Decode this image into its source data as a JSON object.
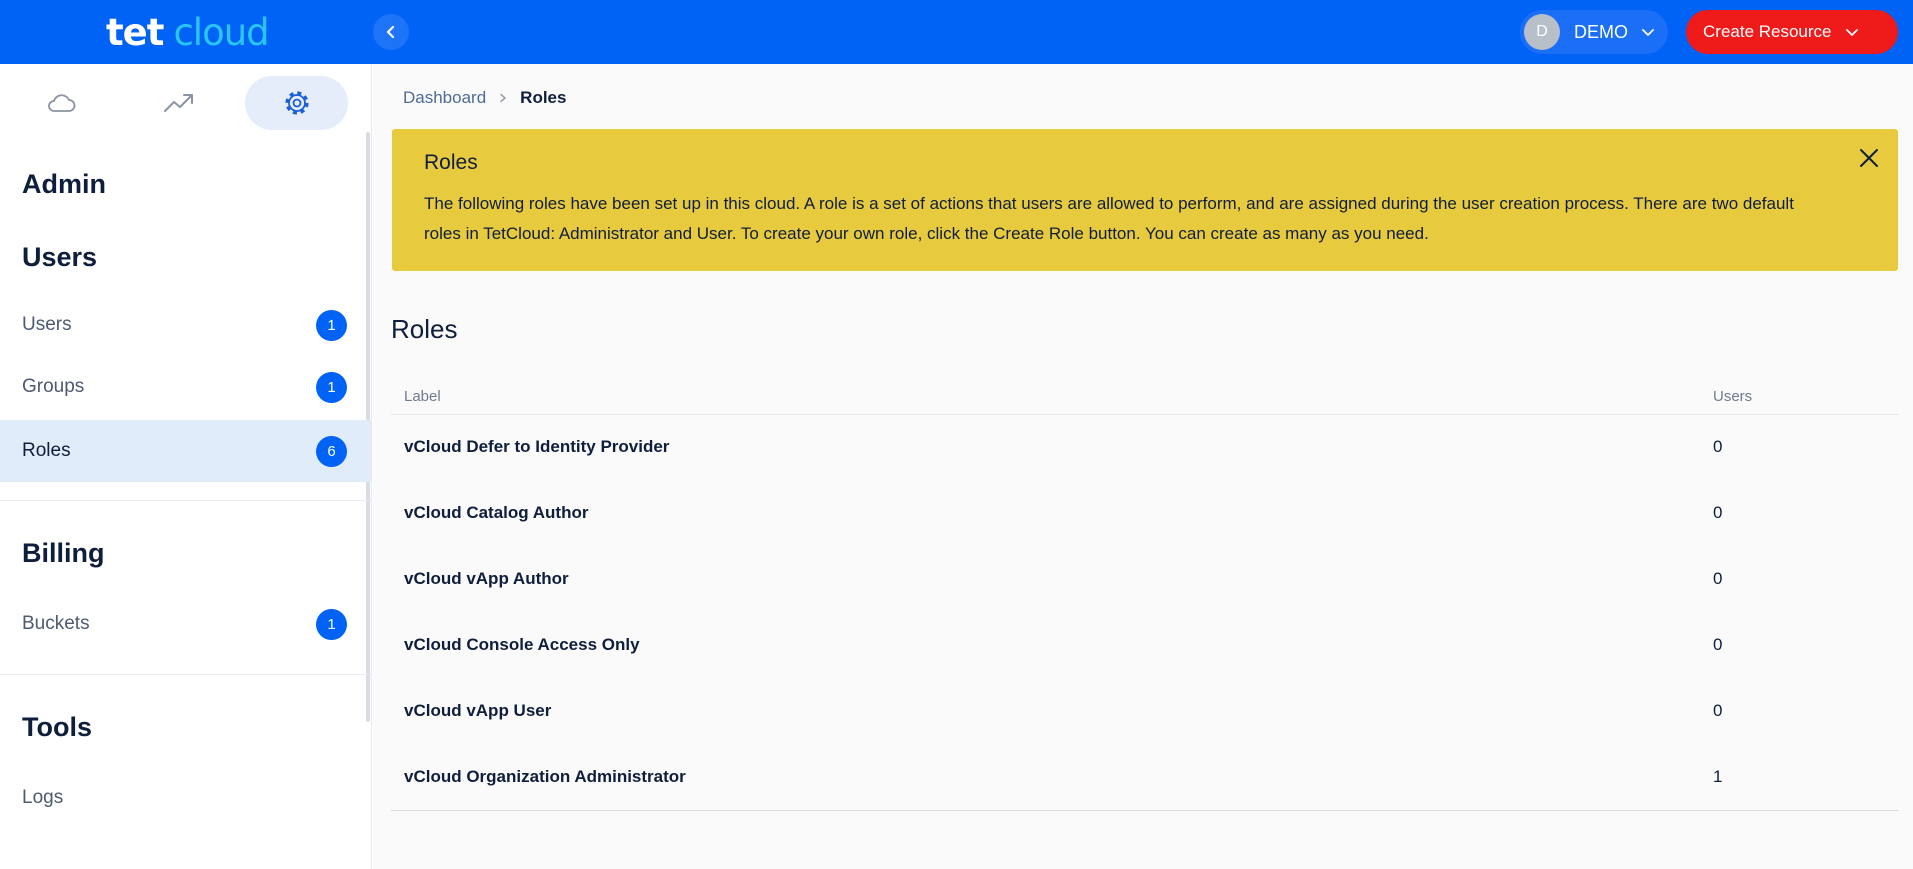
{
  "app": {
    "logo_tet": "tet",
    "logo_cloud": "cloud"
  },
  "topbar": {
    "account_initial": "D",
    "account_name": "DEMO",
    "create_label": "Create Resource"
  },
  "sidebar": {
    "tabs": [
      {
        "icon": "cloud-icon",
        "active": false
      },
      {
        "icon": "trending-up-icon",
        "active": false
      },
      {
        "icon": "gear-icon",
        "active": true
      }
    ],
    "admin_heading": "Admin",
    "users_heading": "Users",
    "items_users": [
      {
        "label": "Users",
        "count": "1"
      },
      {
        "label": "Groups",
        "count": "1"
      },
      {
        "label": "Roles",
        "count": "6"
      }
    ],
    "billing_heading": "Billing",
    "items_billing": [
      {
        "label": "Buckets",
        "count": "1"
      }
    ],
    "tools_heading": "Tools",
    "items_tools": [
      {
        "label": "Logs"
      }
    ]
  },
  "breadcrumb": {
    "parent": "Dashboard",
    "current": "Roles"
  },
  "notice": {
    "title": "Roles",
    "body": "The following roles have been set up in this cloud. A role is a set of actions that users are allowed to perform, and are assigned during the user creation process. There are two default roles in TetCloud: Administrator and User. To create your own role, click the Create Role button. You can create as many as you need."
  },
  "roles": {
    "title": "Roles",
    "columns": {
      "label": "Label",
      "users": "Users"
    },
    "rows": [
      {
        "label": "vCloud Defer to Identity Provider",
        "users": "0"
      },
      {
        "label": "vCloud Catalog Author",
        "users": "0"
      },
      {
        "label": "vCloud vApp Author",
        "users": "0"
      },
      {
        "label": "vCloud Console Access Only",
        "users": "0"
      },
      {
        "label": "vCloud vApp User",
        "users": "0"
      },
      {
        "label": "vCloud Organization Administrator",
        "users": "1"
      }
    ]
  },
  "colors": {
    "primary": "#0063f5",
    "danger": "#ef1a1a",
    "notice": "#e8ca3f",
    "logo_accent": "#29c6f5"
  }
}
